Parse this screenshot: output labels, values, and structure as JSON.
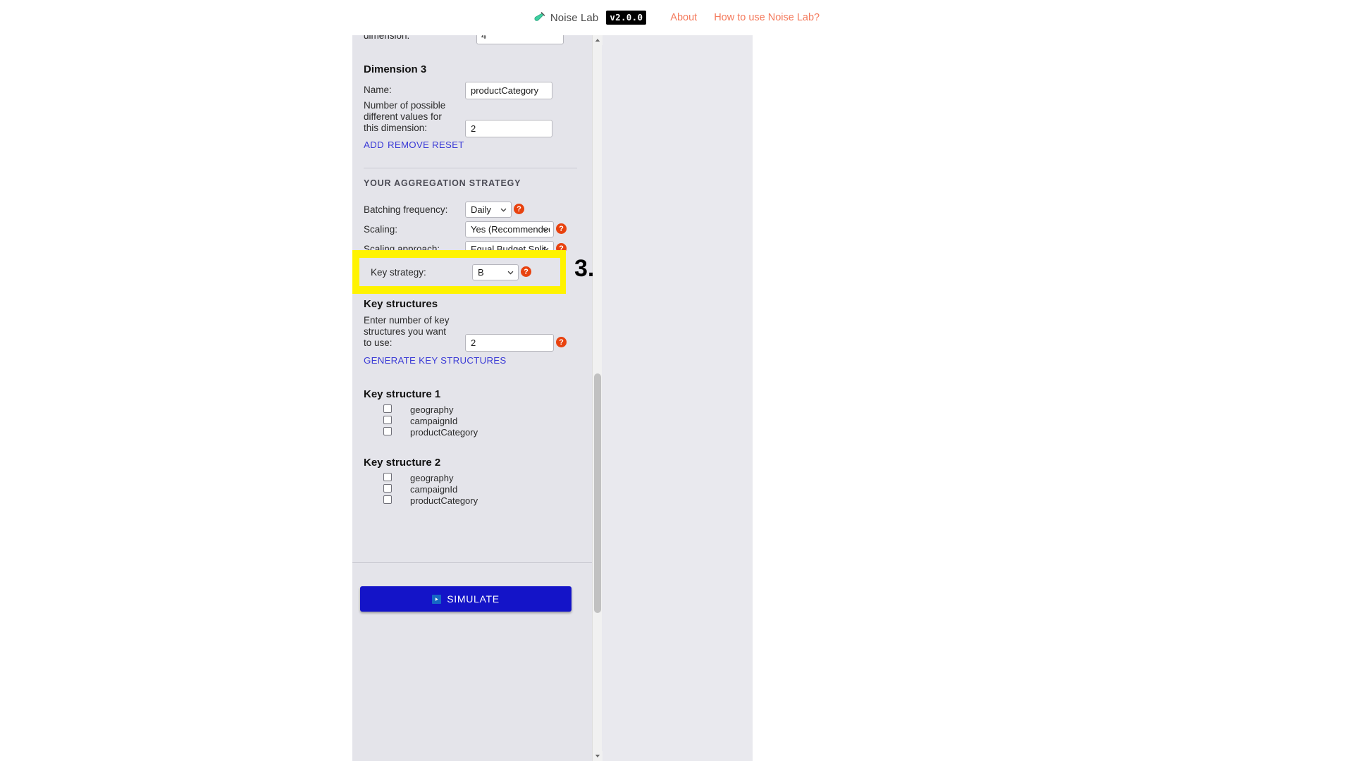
{
  "header": {
    "brand_name": "Noise Lab",
    "version_badge": "v2.0.0",
    "tube_icon": "test-tube-icon",
    "nav": [
      {
        "label": "About"
      },
      {
        "label": "How to use Noise Lab?"
      }
    ],
    "link_color": "#f4795b"
  },
  "clipped_row": {
    "label": "dimension:",
    "value": "4"
  },
  "dimension3": {
    "title": "Dimension 3",
    "name_label": "Name:",
    "name_value": "productCategory",
    "count_label": "Number of possible different values for this dimension:",
    "count_value": "2",
    "actions": [
      {
        "label": "ADD"
      },
      {
        "label": "REMOVE"
      },
      {
        "label": "RESET"
      }
    ]
  },
  "aggregation": {
    "section_title": "YOUR AGGREGATION STRATEGY",
    "rows": [
      {
        "label": "Batching frequency:",
        "value": "Daily",
        "help": "?"
      },
      {
        "label": "Scaling:",
        "value": "Yes (Recommended)",
        "help": "?"
      },
      {
        "label": "Scaling approach:",
        "value": "Equal Budget Split",
        "help": "?"
      }
    ],
    "key_strategy": {
      "label": "Key strategy:",
      "value": "B",
      "help": "?",
      "annotation": "3.",
      "highlight_color": "#fff300"
    }
  },
  "key_structures": {
    "title": "Key structures",
    "count_label": "Enter number of key structures you want to use:",
    "count_value": "2",
    "help": "?",
    "generate_label": "GENERATE KEY STRUCTURES",
    "groups": [
      {
        "title": "Key structure 1",
        "options": [
          {
            "label": "geography",
            "checked": false
          },
          {
            "label": "campaignId",
            "checked": false
          },
          {
            "label": "productCategory",
            "checked": false
          }
        ]
      },
      {
        "title": "Key structure 2",
        "options": [
          {
            "label": "geography",
            "checked": false
          },
          {
            "label": "campaignId",
            "checked": false
          },
          {
            "label": "productCategory",
            "checked": false
          }
        ]
      }
    ]
  },
  "footer": {
    "simulate_label": "SIMULATE",
    "simulate_icon": "play-icon",
    "simulate_color": "#1414c8"
  }
}
